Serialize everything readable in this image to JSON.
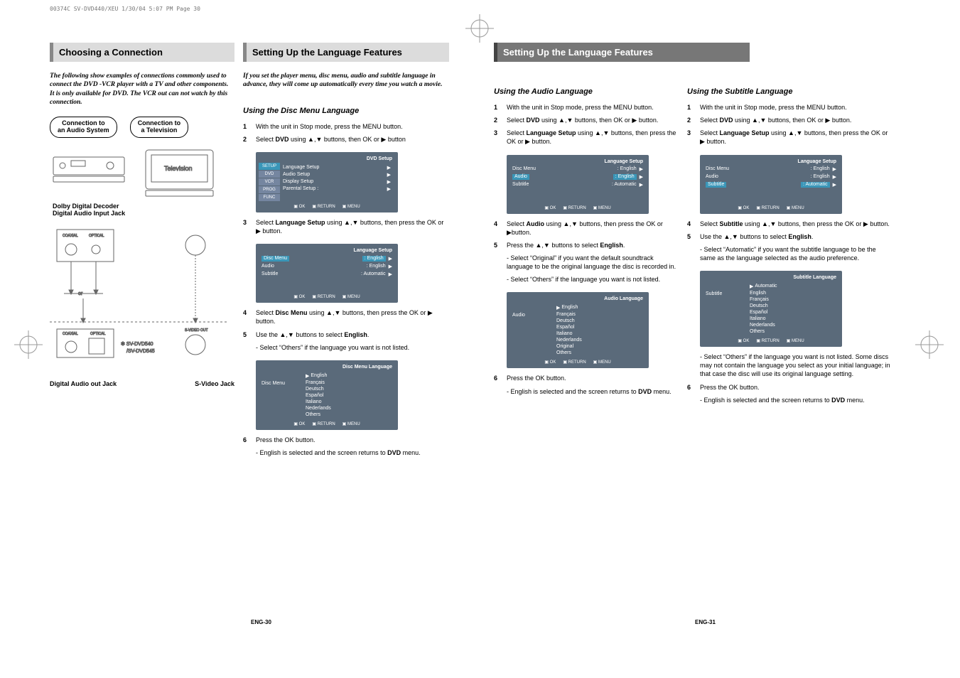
{
  "doc_header": "00374C SV-DVD440/XEU  1/30/04 5:07 PM  Page 30",
  "page_left_footer": "ENG-30",
  "page_right_footer": "ENG-31",
  "left_page": {
    "col1": {
      "title": "Choosing a Connection",
      "intro": "The following show examples of connections commonly used to connect the DVD -VCR player with a TV and other components. It is only available for DVD. The VCR out can not watch by this connection.",
      "pill1_a": "Connection to",
      "pill1_b": "an Audio System",
      "pill2_a": "Connection to",
      "pill2_b": "a Television",
      "cap1_a": "Dolby Digital Decoder",
      "cap1_b": "Digital Audio Input Jack",
      "model_ref": "SV-DVD540 /SV-DVD545",
      "or_label": "or",
      "cap2_a": "Digital Audio out Jack",
      "cap2_b": "S-Video Jack",
      "jack_coaxial": "COAXIAL",
      "jack_optical": "OPTICAL",
      "tv_label": "Television"
    },
    "col2": {
      "title": "Setting Up the Language Features",
      "intro": "If you set the player menu, disc menu, audio and subtitle language in advance, they will come up automatically every time you watch a movie.",
      "subhead": "Using the Disc Menu Language",
      "steps": [
        "With the unit in Stop mode, press the MENU button.",
        "Select <b>DVD</b> using ▲,▼ buttons, then OK or ▶ button"
      ],
      "osd1": {
        "hdr": "DVD Setup",
        "tabs": [
          "SETUP",
          "DVD",
          "VCR",
          "PROG",
          "FUNC"
        ],
        "items": [
          "Language Setup",
          "Audio Setup",
          "Display Setup",
          "Parental Setup   :"
        ],
        "foot": [
          "OK",
          "RETURN",
          "MENU"
        ]
      },
      "step3": "Select <b>Language Setup</b> using ▲,▼ buttons, then press the OK or ▶ button.",
      "osd2": {
        "hdr": "Language Setup",
        "rows": [
          {
            "k": "Disc Menu",
            "v": ": English"
          },
          {
            "k": "Audio",
            "v": ": English"
          },
          {
            "k": "Subtitle",
            "v": ": Automatic"
          }
        ],
        "foot": [
          "OK",
          "RETURN",
          "MENU"
        ]
      },
      "step4": "Select <b>Disc Menu</b> using ▲,▼ buttons, then press the OK or ▶ button.",
      "step5": "Use the ▲,▼ buttons to select <b>English</b>.",
      "step5_sub": "- Select “Others” if the language you want is not listed.",
      "osd3": {
        "hdr": "Disc Menu Language",
        "label": "Disc Menu",
        "list": [
          "English",
          "Français",
          "Deutsch",
          "Español",
          "Italiano",
          "Nederlands",
          "Others"
        ],
        "foot": [
          "OK",
          "RETURN",
          "MENU"
        ]
      },
      "step6": "Press the OK button.",
      "step6_sub": "- English is selected and the screen returns to <b>DVD</b> menu."
    }
  },
  "right_page": {
    "title": "Setting Up the Language Features",
    "col1": {
      "subhead": "Using the Audio Language",
      "steps": [
        "With the unit in Stop mode, press the MENU button.",
        "Select <b>DVD</b> using ▲,▼ buttons, then OK or ▶ button.",
        "Select <b>Language Setup</b> using ▲,▼ buttons, then press the OK or ▶ button."
      ],
      "osd1": {
        "hdr": "Language Setup",
        "rows": [
          {
            "k": "Disc Menu",
            "v": ": English"
          },
          {
            "k": "Audio",
            "v": ": English"
          },
          {
            "k": "Subtitle",
            "v": ": Automatic"
          }
        ],
        "foot": [
          "OK",
          "RETURN",
          "MENU"
        ]
      },
      "step4": "Select <b>Audio</b> using ▲,▼ buttons, then press the OK or ▶button.",
      "step5": "Press the ▲,▼ buttons to select <b>English</b>.",
      "step5_sub1": "- Select “Original” if you want the default soundtrack language to be the original language the disc is recorded in.",
      "step5_sub2": "- Select “Others” if the language you want is not listed.",
      "osd2": {
        "hdr": "Audio Language",
        "label": "Audio",
        "list": [
          "English",
          "Français",
          "Deutsch",
          "Español",
          "Italiano",
          "Nederlands",
          "Original",
          "Others"
        ],
        "foot": [
          "OK",
          "RETURN",
          "MENU"
        ]
      },
      "step6": "Press the OK button.",
      "step6_sub": "- English is selected and the screen returns to <b>DVD</b> menu."
    },
    "col2": {
      "subhead": "Using the Subtitle Language",
      "steps": [
        "With the unit in Stop mode, press the MENU button.",
        "Select <b>DVD</b> using ▲,▼ buttons, then OK or ▶ button.",
        "Select <b>Language Setup</b> using ▲,▼ buttons, then press the OK or ▶ button."
      ],
      "osd1": {
        "hdr": "Language Setup",
        "rows": [
          {
            "k": "Disc Menu",
            "v": ": English"
          },
          {
            "k": "Audio",
            "v": ": English"
          },
          {
            "k": "Subtitle",
            "v": ": Automatic"
          }
        ],
        "foot": [
          "OK",
          "RETURN",
          "MENU"
        ]
      },
      "step4": "Select <b>Subtitle</b> using ▲,▼ buttons, then press the OK or ▶ button.",
      "step5": "Use the ▲,▼ buttons to select <b>English</b>.",
      "step5_sub": "- Select “Automatic” if you want the subtitle language to be the same as the language selected as the audio preference.",
      "osd2": {
        "hdr": "Subtitle Language",
        "label": "Subtitle",
        "list": [
          "Automatic",
          "English",
          "Français",
          "Deutsch",
          "Español",
          "Italiano",
          "Nederlands",
          "Others"
        ],
        "foot": [
          "OK",
          "RETURN",
          "MENU"
        ]
      },
      "note": "- Select “Others” if the language you want is not listed. Some discs may not contain the language you select as your initial language; in that case the disc will use its original language setting.",
      "step6": "Press the OK button.",
      "step6_sub": "- English is selected and the screen returns to <b>DVD</b> menu."
    }
  }
}
